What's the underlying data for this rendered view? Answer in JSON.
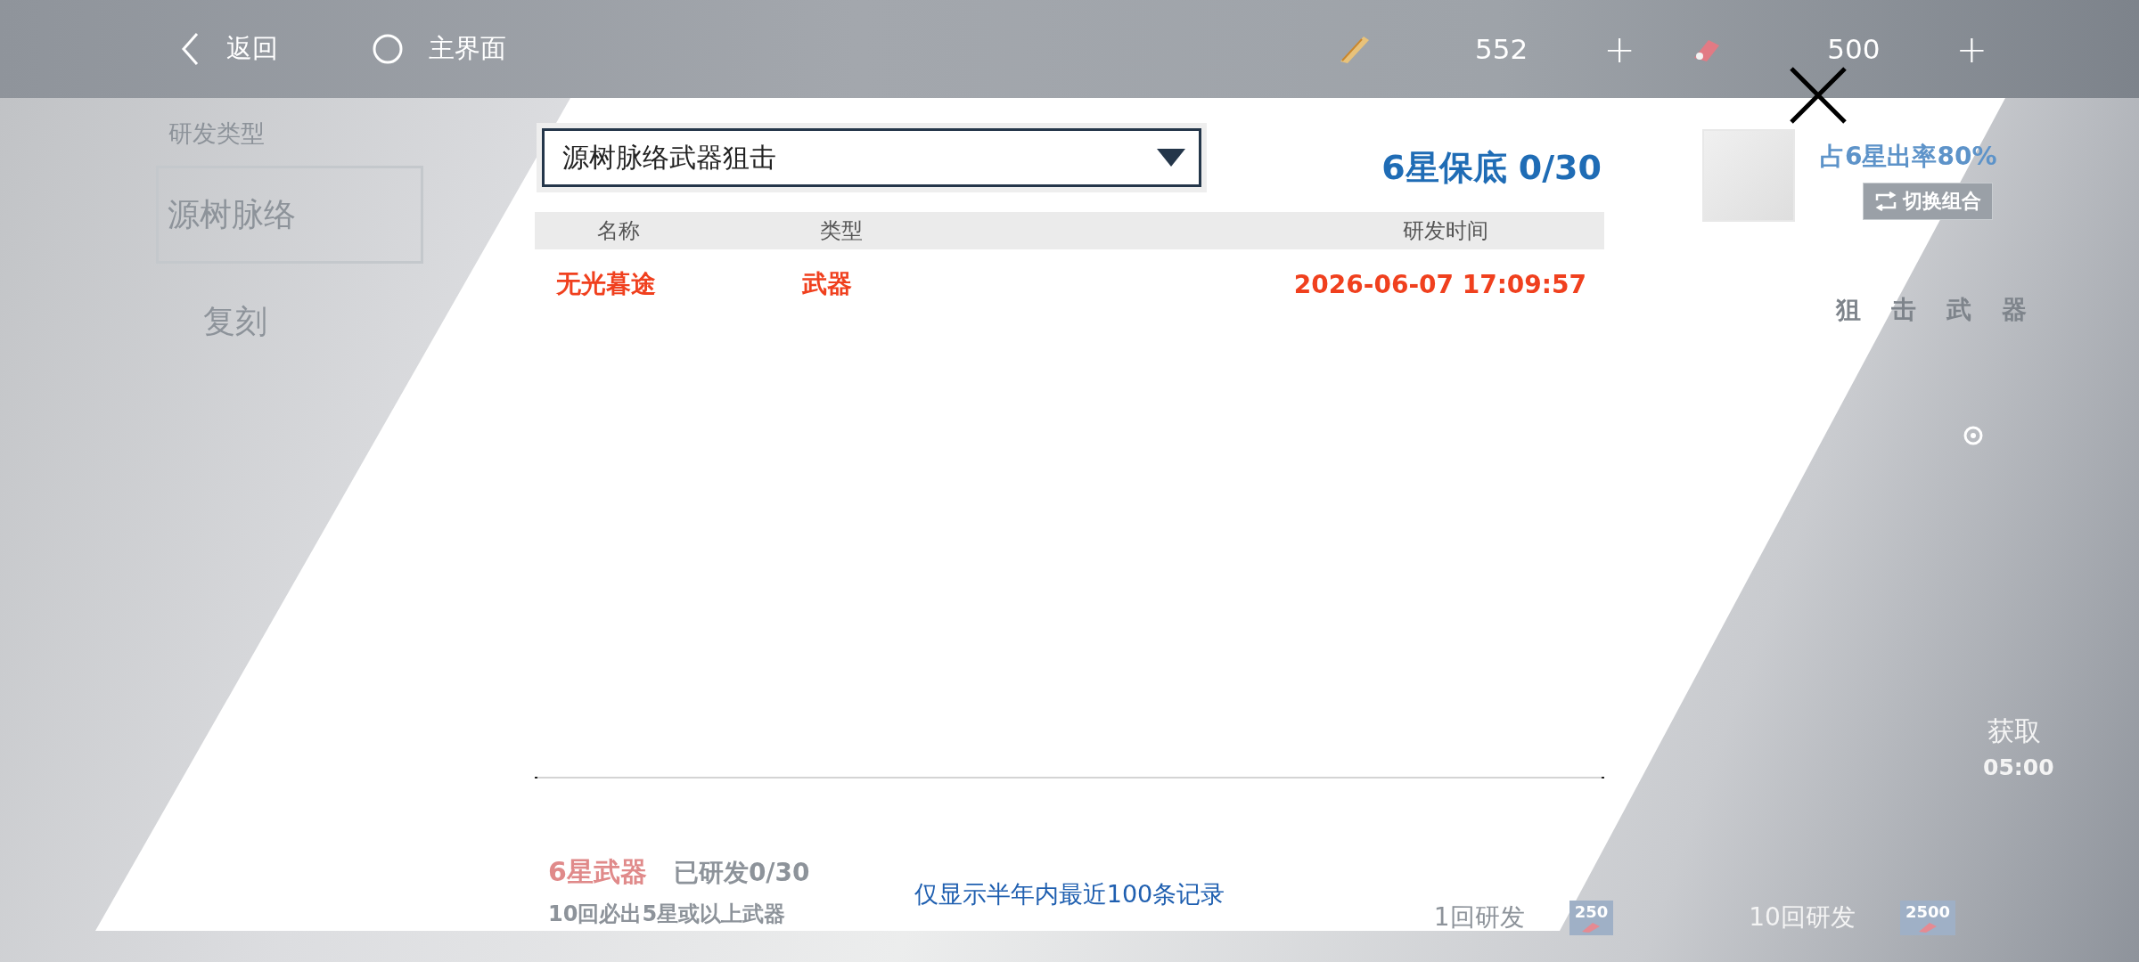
{
  "top_bar": {
    "back_label": "返回",
    "home_label": "主界面",
    "currencies": [
      {
        "amount": "552",
        "add": "+"
      },
      {
        "amount": "500",
        "add": "+"
      }
    ]
  },
  "sidebar": {
    "title": "研发类型",
    "items": [
      {
        "title": "源树脉络",
        "selected": true
      },
      {
        "title": "复刻",
        "selected": false
      }
    ]
  },
  "banner": {
    "rate": "占6星出率80%",
    "switch_button": "切换组合",
    "weapon_type": "狙击武器",
    "obtain": "获取",
    "timer": "05:00"
  },
  "bottom": {
    "guarantee_title": "6星武器",
    "progress": "已研发0/30",
    "note": "10回必出5星或以上武器",
    "pulls": [
      {
        "label": "1回研发",
        "cost": "250"
      },
      {
        "label": "10回研发",
        "cost": "2500"
      }
    ]
  },
  "modal": {
    "dropdown": {
      "value": "源树脉络武器狙击"
    },
    "pity": "6星保底 0/30",
    "table": {
      "columns": [
        "名称",
        "类型",
        "研发时间"
      ],
      "rows": [
        [
          "无光暮途",
          "武器",
          "2026-06-07 17:09:57"
        ]
      ]
    },
    "footer": "仅显示半年内最近100条记录"
  }
}
